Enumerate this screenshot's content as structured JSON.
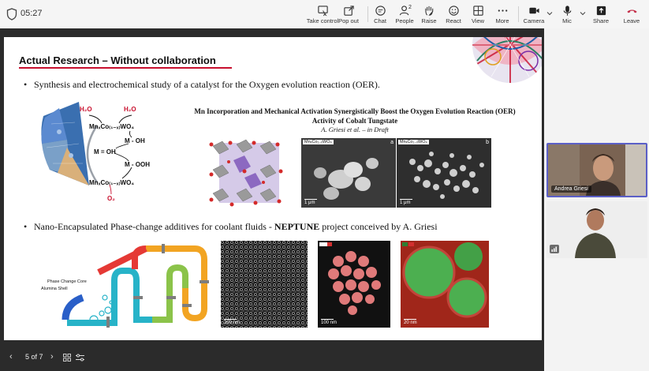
{
  "meeting": {
    "timer": "05:27",
    "toolbar": [
      {
        "name": "take-control",
        "label": "Take control"
      },
      {
        "name": "pop-out",
        "label": "Pop out"
      },
      {
        "name": "chat",
        "label": "Chat"
      },
      {
        "name": "people",
        "label": "People",
        "count": "2"
      },
      {
        "name": "raise",
        "label": "Raise"
      },
      {
        "name": "react",
        "label": "React"
      },
      {
        "name": "view",
        "label": "View"
      },
      {
        "name": "more",
        "label": "More"
      },
      {
        "name": "camera",
        "label": "Camera"
      },
      {
        "name": "mic",
        "label": "Mic"
      },
      {
        "name": "share",
        "label": "Share"
      },
      {
        "name": "leave",
        "label": "Leave"
      }
    ],
    "leave_color": "#c4314b",
    "accent": "#5b5fc7"
  },
  "slide": {
    "title": "Actual Research – Without collaboration",
    "bullet1": "Synthesis and electrochemical study of a catalyst for the Oxygen evolution reaction (OER).",
    "paper_title": "Mn Incorporation and Mechanical Activation Synergistically Boost the Oxygen Evolution Reaction (OER) Activity of Cobalt Tungstate",
    "paper_author": "A. Griesi et al. – in Draft",
    "mechanism": {
      "h2o_1": "H₂O",
      "h2o_2": "H₂O",
      "catalyst_top": "MnₓCo₍₁₋ₓ₎WO₄",
      "m_oh_left": "M = OH",
      "m_oh_right": "M - OH",
      "m_ooh": "M - OOH",
      "catalyst_bottom": "MnₓCo₍₁₋ₓ₎WO₄",
      "o2": "O₂"
    },
    "sem1": {
      "label": "MnₓCo₁₋ₓWO₄",
      "letter": "a",
      "scale": "1 μm"
    },
    "sem2": {
      "label": "MnₓCo₁₋ₓWO₄",
      "letter": "b",
      "scale": "1 μm"
    },
    "bullet2_pre": "Nano-Encapsulated Phase-change additives for coolant fluids - ",
    "bullet2_bold": "NEPTUNE",
    "bullet2_post": " project conceived by A. Griesi",
    "pcc_core": "Phase Change Core",
    "pcc_shell": "Alumina Shell",
    "tem1": {
      "scale": "200 nm"
    },
    "tem2": {
      "scale": "100 nm"
    },
    "tem3": {
      "scale": "20 nm"
    }
  },
  "presenter": {
    "page_indicator": "5 of 7"
  },
  "participants": [
    {
      "name": "Andrea Griesi"
    }
  ]
}
